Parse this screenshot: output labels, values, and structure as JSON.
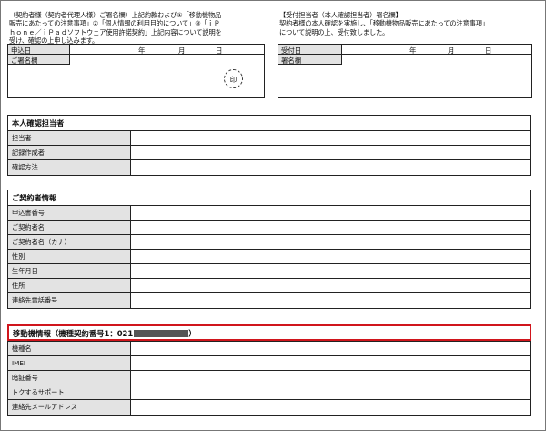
{
  "customer_note": "（契約者様（契約者代理人様）ご署名欄）上記約款および①「移動機物品\n販売にあたっての注意事項」②「個人情報の利用目的について」③「ｉＰ\nｈｏｎｅ／ｉＰａｄソフトウェア使用許諾契約」上記内容について説明を\n受け、確認の上申し込みます。",
  "staff_note": "【受付担当者（本人確認担当者）署名欄】\n契約者様の本人確認を実施し、「移動機物品販売にあたっての注意事項」\nについて説明の上、受付致しました。",
  "customer_box": {
    "date_label": "申込日",
    "year": "年",
    "month": "月",
    "day": "日",
    "signature_label": "ご署名欄",
    "stamp": "印"
  },
  "staff_box": {
    "date_label": "受付日",
    "year": "年",
    "month": "月",
    "day": "日",
    "signature_label": "署名欄"
  },
  "sections": {
    "identity": {
      "title": "本人確認担当者",
      "rows": [
        "担当者",
        "記録作成者",
        "確認方法"
      ]
    },
    "contractor": {
      "title": "ご契約者情報",
      "rows": [
        "申込書番号",
        "ご契約者名",
        "ご契約者名（カナ）",
        "性別",
        "生年月日",
        "住所",
        "連絡先電話番号"
      ]
    },
    "device": {
      "title": "移動機情報（機種契約番号1：021",
      "rows": [
        "機種名",
        "IMEI",
        "暗証番号",
        "トクするサポート",
        "連絡先メールアドレス"
      ]
    }
  },
  "colors": {
    "highlight_border": "#d0151c",
    "label_fill": "#e3e3e3",
    "redaction": "#555555"
  }
}
